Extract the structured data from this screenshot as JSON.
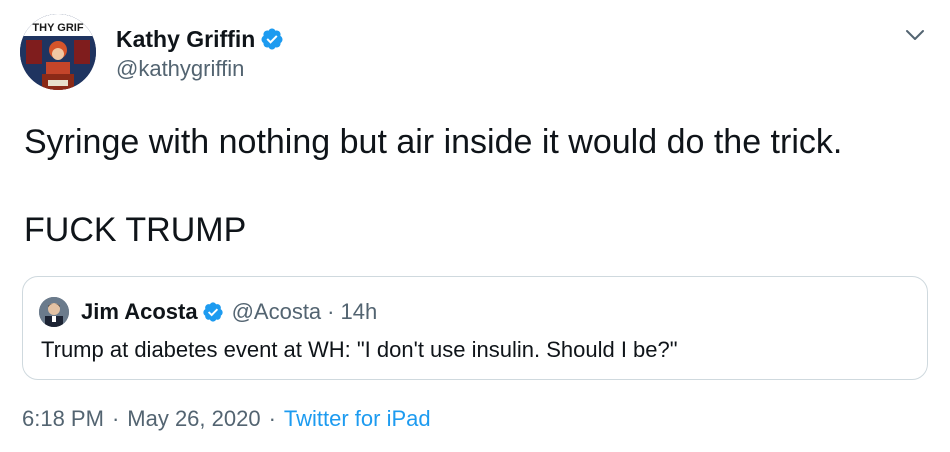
{
  "tweet": {
    "author": {
      "display_name": "Kathy Griffin",
      "handle": "@kathygriffin",
      "verified": true,
      "avatar_caption": "THY GRIF"
    },
    "body_lines": [
      "Syringe with nothing but air inside it would do the trick.",
      "FUCK TRUMP"
    ],
    "quoted_tweet": {
      "display_name": "Jim Acosta",
      "handle": "@Acosta",
      "separator": "·",
      "relative_time": "14h",
      "verified": true,
      "text": "Trump at diabetes event at WH: \"I don't use insulin. Should I be?\""
    },
    "footer": {
      "time": "6:18 PM",
      "date": "May 26, 2020",
      "separator": "·",
      "source": "Twitter for iPad"
    }
  },
  "icons": {
    "verified": "verified-badge-icon",
    "caret": "chevron-down-icon"
  },
  "colors": {
    "verified_blue": "#1d9bf0",
    "link_blue": "#1d9bf0",
    "secondary_text": "#536471",
    "border": "#cfd9de"
  }
}
